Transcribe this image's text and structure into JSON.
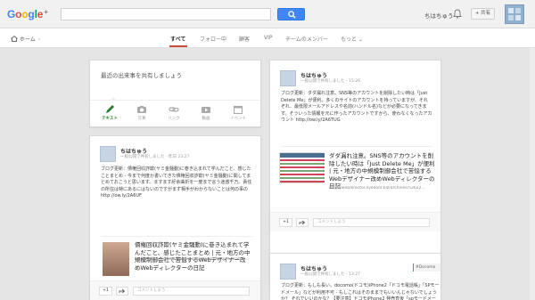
{
  "header": {
    "logo_text": "Google",
    "logo_plus": "+",
    "search_value": "",
    "user_name": "ちはちゅう",
    "share_label": "+ 共有"
  },
  "nav": {
    "home_label": "ホーム",
    "tabs": [
      {
        "label": "すべて"
      },
      {
        "label": "フォロー中"
      },
      {
        "label": "顧客"
      },
      {
        "label": "VIP"
      },
      {
        "label": "チームのメンバー"
      },
      {
        "label": "もっと"
      }
    ]
  },
  "composer": {
    "prompt": "最近の出来事を共有しましょう",
    "options": [
      {
        "label": "テキスト"
      },
      {
        "label": "写真"
      },
      {
        "label": "リンク"
      },
      {
        "label": "動画"
      },
      {
        "label": "イベント"
      }
    ]
  },
  "posts": [
    {
      "author": "ちはちゅう",
      "meta": "一般公開で共有しました - 昨日 23:27",
      "body": "ブログ更新：債権回収詐欺(ヤミ金騒動)に巻き込まれて学んだこと、感じたことまとめ - 今まで何度か書いてきた債権回収詐欺(ヤミ金騒動)に関してまとめておこうと思います。ますます紆余曲折を一度まで言う迷惑千万。責任の所在は特にあるにはないのですがまず相手がわからないことは何の事の http://ow.ly/2A6UF",
      "link_title": "債権回収詐欺(ヤミ金騒動)に巻き込まれて学んだこと、感じたことまとめ | 元・地方の中規模制御会社で苦悩するWebデザイナー改めWebディレクターの日記",
      "link_url": "http://webdirector.livedoor.biz/archives/52620926.html",
      "plus1": "+1",
      "comment_placeholder": "コメントしよう"
    },
    {
      "author": "ちはちゅう",
      "meta": "一般公開で共有しました - 15:26",
      "body": "ブログ更新：ダダ漏れ注意。SNS等のアカウントを削除したい時は「Just Delete Me」が便利。多くのサイトのアカウントを持っていますが、それぞれ、最低限メールアドレスや名前(ハンドル名)などが必要になってきます。そういった情報を元に作ったアカウントですから、使わなくなったアカウント http://ow.ly/2A6TUG",
      "link_title": "ダダ漏れ注意。SNS等のアカウントを削除したい時は「Just Delete Me」が便利 | 元・地方の中規模制御会社で苦悩するWebデザイナー改めWebディレクターの日記",
      "link_url": "http://webdirector.livedoor.biz/archives/52622...",
      "plus1": "+1",
      "comment_placeholder": "コメントしよう"
    },
    {
      "author": "ちはちゅう",
      "meta": "一般公開で共有しました - 13:27",
      "tag": "#Docomo",
      "body": "ブログ更新：もしも長い。docomo(ドコモ)iPhone2「ドコモ電話帳」「SPモードメール」などが利用不可 - もしこれはそのままでもいいんじゃないでしょうか？ それでいいのかな？【要注意】ドコモiPhone2 発売直後「spモードメール」"
    }
  ],
  "colors": {
    "accent_blue": "#4285f4",
    "tab_active": "#d14836",
    "composer_active": "#2e7d32"
  }
}
